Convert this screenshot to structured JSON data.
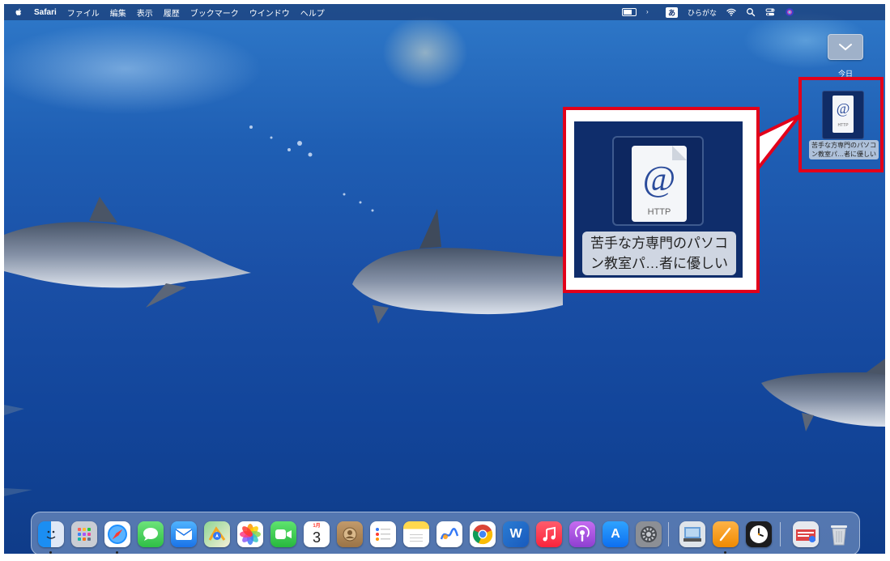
{
  "menubar": {
    "app_name": "Safari",
    "menus": [
      "ファイル",
      "編集",
      "表示",
      "履歴",
      "ブックマーク",
      "ウインドウ",
      "ヘルプ"
    ],
    "input_method_badge": "あ",
    "input_method_label": "ひらがな"
  },
  "desktop": {
    "stack_label": "今日",
    "file": {
      "icon_text": "HTTP",
      "name_line1": "苦手な方専門のパソコ",
      "name_line2": "ン教室パ…者に優しい"
    }
  },
  "callout": {
    "icon_text": "HTTP",
    "name_line1": "苦手な方専門のパソコ",
    "name_line2": "ン教室パ…者に優しい",
    "border_color": "#e2001a"
  },
  "dock": {
    "apps": [
      "finder",
      "launchpad",
      "safari",
      "messages",
      "mail",
      "maps",
      "photos",
      "facetime",
      "calendar",
      "contacts",
      "reminders",
      "notes",
      "freeform",
      "chrome",
      "word",
      "music",
      "podcasts",
      "app-store",
      "system-settings",
      "preview",
      "pages",
      "clock",
      "downloads-stack",
      "trash"
    ],
    "calendar_month": "1月",
    "calendar_day": "3",
    "word_letter": "W",
    "appstore_letter": "A"
  }
}
